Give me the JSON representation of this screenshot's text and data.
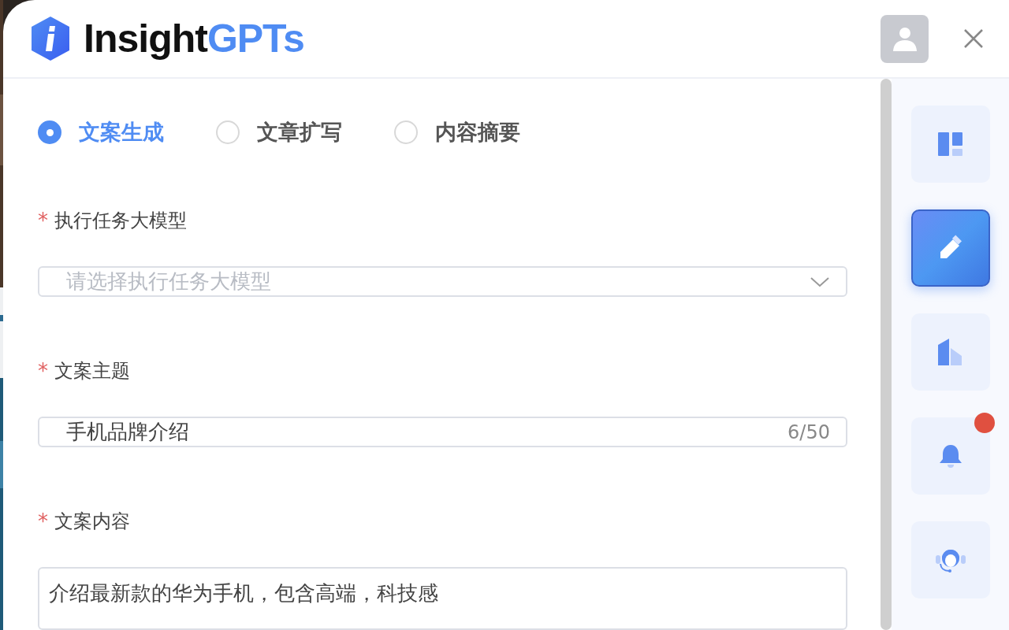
{
  "header": {
    "brand_main": "Insight",
    "brand_accent": "GPTs"
  },
  "modes": [
    {
      "label": "文案生成",
      "selected": true
    },
    {
      "label": "文章扩写",
      "selected": false
    },
    {
      "label": "内容摘要",
      "selected": false
    }
  ],
  "fields": [
    {
      "kind": "select",
      "label": "执行任务大模型",
      "required_mark": "*",
      "placeholder": "请选择执行任务大模型"
    },
    {
      "kind": "input",
      "label": "文案主题",
      "required_mark": "*",
      "value": "手机品牌介绍",
      "counter": "6/50"
    },
    {
      "kind": "textarea",
      "label": "文案内容",
      "required_mark": "*",
      "value": "介绍最新款的华为手机，包含高端，科技感"
    }
  ],
  "rail": [
    {
      "kind": "layout",
      "selected": false,
      "badge": false
    },
    {
      "kind": "edit",
      "selected": true,
      "badge": false
    },
    {
      "kind": "building",
      "selected": false,
      "badge": false
    },
    {
      "kind": "bell",
      "selected": false,
      "badge": true
    },
    {
      "kind": "support",
      "selected": false,
      "badge": false
    }
  ]
}
